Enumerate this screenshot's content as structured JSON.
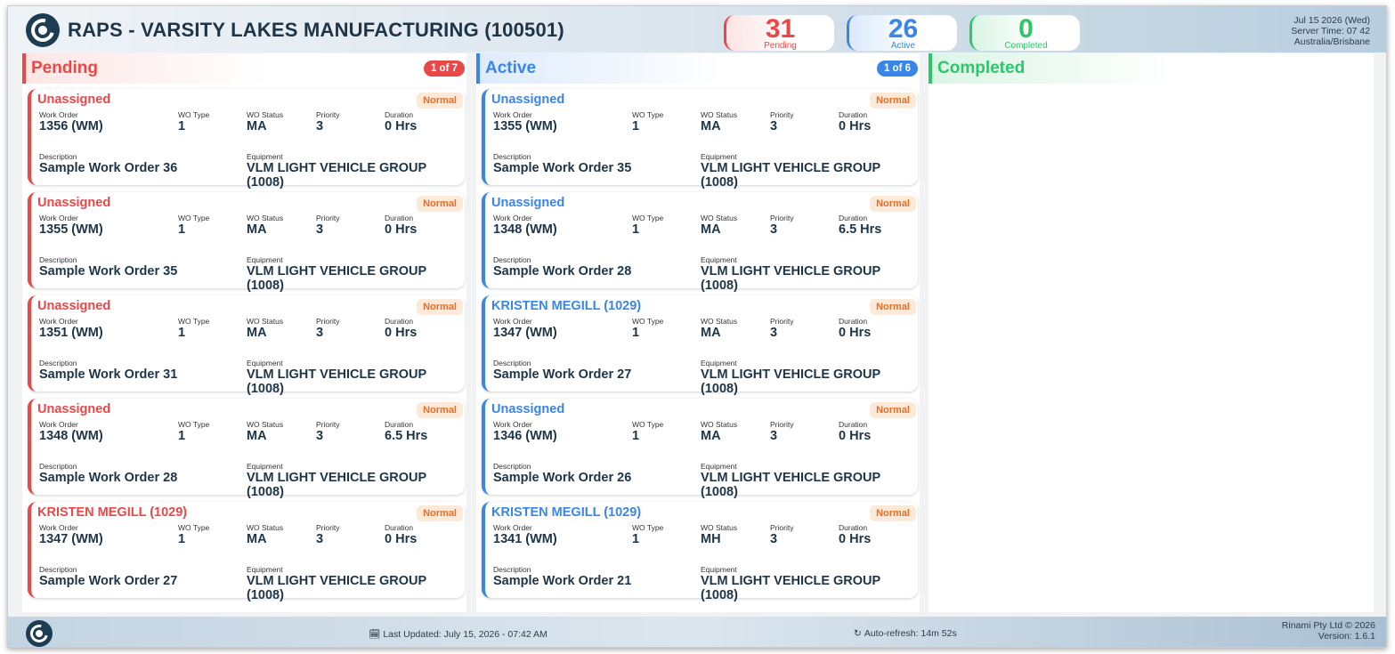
{
  "header": {
    "title": "RAPS - VARSITY LAKES MANUFACTURING (100501)",
    "stats": {
      "pending": {
        "count": "31",
        "label": "Pending"
      },
      "active": {
        "count": "26",
        "label": "Active"
      },
      "completed": {
        "count": "0",
        "label": "Completed"
      }
    },
    "server": {
      "date": "Jul 15 2026 (Wed)",
      "time": "Server Time: 07 42",
      "timezone": "Australia/Brisbane"
    }
  },
  "field_labels": {
    "work_order": "Work Order",
    "wo_type": "WO Type",
    "wo_status": "WO Status",
    "priority": "Priority",
    "duration": "Duration",
    "description": "Description",
    "equipment": "Equipment"
  },
  "columns": {
    "pending": {
      "title": "Pending",
      "pager": "1 of 7",
      "cards": [
        {
          "assignee": "Unassigned",
          "priority_label": "Normal",
          "work_order": "1356 (WM)",
          "wo_type": "1",
          "wo_status": "MA",
          "priority": "3",
          "duration": "0 Hrs",
          "description": "Sample Work Order 36",
          "equipment": "VLM LIGHT VEHICLE GROUP (1008)"
        },
        {
          "assignee": "Unassigned",
          "priority_label": "Normal",
          "work_order": "1355 (WM)",
          "wo_type": "1",
          "wo_status": "MA",
          "priority": "3",
          "duration": "0 Hrs",
          "description": "Sample Work Order 35",
          "equipment": "VLM LIGHT VEHICLE GROUP (1008)"
        },
        {
          "assignee": "Unassigned",
          "priority_label": "Normal",
          "work_order": "1351 (WM)",
          "wo_type": "1",
          "wo_status": "MA",
          "priority": "3",
          "duration": "0 Hrs",
          "description": "Sample Work Order 31",
          "equipment": "VLM LIGHT VEHICLE GROUP (1008)"
        },
        {
          "assignee": "Unassigned",
          "priority_label": "Normal",
          "work_order": "1348 (WM)",
          "wo_type": "1",
          "wo_status": "MA",
          "priority": "3",
          "duration": "6.5 Hrs",
          "description": "Sample Work Order 28",
          "equipment": "VLM LIGHT VEHICLE GROUP (1008)"
        },
        {
          "assignee": "KRISTEN MEGILL (1029)",
          "priority_label": "Normal",
          "work_order": "1347 (WM)",
          "wo_type": "1",
          "wo_status": "MA",
          "priority": "3",
          "duration": "0 Hrs",
          "description": "Sample Work Order 27",
          "equipment": "VLM LIGHT VEHICLE GROUP (1008)"
        }
      ]
    },
    "active": {
      "title": "Active",
      "pager": "1 of 6",
      "cards": [
        {
          "assignee": "Unassigned",
          "priority_label": "Normal",
          "work_order": "1355 (WM)",
          "wo_type": "1",
          "wo_status": "MA",
          "priority": "3",
          "duration": "0 Hrs",
          "description": "Sample Work Order 35",
          "equipment": "VLM LIGHT VEHICLE GROUP (1008)"
        },
        {
          "assignee": "Unassigned",
          "priority_label": "Normal",
          "work_order": "1348 (WM)",
          "wo_type": "1",
          "wo_status": "MA",
          "priority": "3",
          "duration": "6.5 Hrs",
          "description": "Sample Work Order 28",
          "equipment": "VLM LIGHT VEHICLE GROUP (1008)"
        },
        {
          "assignee": "KRISTEN MEGILL (1029)",
          "priority_label": "Normal",
          "work_order": "1347 (WM)",
          "wo_type": "1",
          "wo_status": "MA",
          "priority": "3",
          "duration": "0 Hrs",
          "description": "Sample Work Order 27",
          "equipment": "VLM LIGHT VEHICLE GROUP (1008)"
        },
        {
          "assignee": "Unassigned",
          "priority_label": "Normal",
          "work_order": "1346 (WM)",
          "wo_type": "1",
          "wo_status": "MA",
          "priority": "3",
          "duration": "0 Hrs",
          "description": "Sample Work Order 26",
          "equipment": "VLM LIGHT VEHICLE GROUP (1008)"
        },
        {
          "assignee": "KRISTEN MEGILL (1029)",
          "priority_label": "Normal",
          "work_order": "1341 (WM)",
          "wo_type": "1",
          "wo_status": "MH",
          "priority": "3",
          "duration": "0 Hrs",
          "description": "Sample Work Order 21",
          "equipment": "VLM LIGHT VEHICLE GROUP (1008)"
        }
      ]
    },
    "completed": {
      "title": "Completed"
    }
  },
  "footer": {
    "last_updated": "Last Updated: July 15, 2026 - 07:42 AM",
    "auto_refresh": "Auto-refresh: 14m 52s",
    "copyright": "Rinami Pty Ltd © 2026",
    "version": "Version: 1.6.1"
  },
  "colors": {
    "pending": "#e84848",
    "active": "#3a86e6",
    "completed": "#2ec56b",
    "priority_normal": "#e0702b",
    "text_dark": "#1e3547"
  },
  "icons": {
    "calendar": "calendar-icon",
    "refresh": "refresh-icon",
    "logo": "raps-logo-icon"
  }
}
